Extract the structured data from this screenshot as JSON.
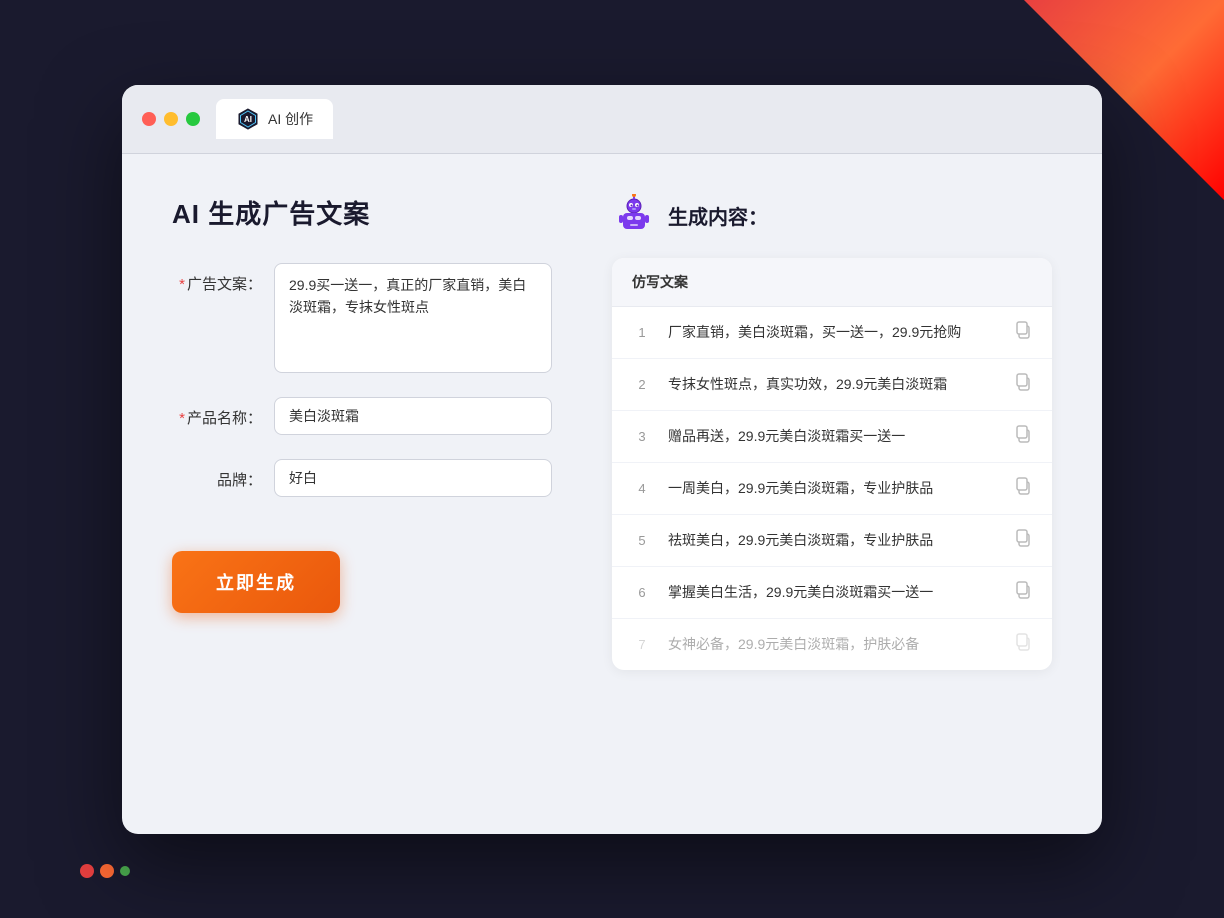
{
  "background": {
    "colors": {
      "main": "#1a1a2e",
      "accent_red": "#e84040"
    }
  },
  "browser": {
    "tab": {
      "label": "AI 创作"
    },
    "window_controls": {
      "close_label": "",
      "minimize_label": "",
      "maximize_label": ""
    }
  },
  "page": {
    "title": "AI 生成广告文案"
  },
  "form": {
    "ad_copy_label": "广告文案：",
    "ad_copy_required": "*",
    "ad_copy_value": "29.9买一送一，真正的厂家直销，美白淡斑霜，专抹女性斑点",
    "product_name_label": "产品名称：",
    "product_name_required": "*",
    "product_name_value": "美白淡斑霜",
    "brand_label": "品牌：",
    "brand_value": "好白",
    "generate_button": "立即生成"
  },
  "result": {
    "header_title": "生成内容：",
    "table_header": "仿写文案",
    "items": [
      {
        "num": "1",
        "text": "厂家直销，美白淡斑霜，买一送一，29.9元抢购",
        "dimmed": false
      },
      {
        "num": "2",
        "text": "专抹女性斑点，真实功效，29.9元美白淡斑霜",
        "dimmed": false
      },
      {
        "num": "3",
        "text": "赠品再送，29.9元美白淡斑霜买一送一",
        "dimmed": false
      },
      {
        "num": "4",
        "text": "一周美白，29.9元美白淡斑霜，专业护肤品",
        "dimmed": false
      },
      {
        "num": "5",
        "text": "祛斑美白，29.9元美白淡斑霜，专业护肤品",
        "dimmed": false
      },
      {
        "num": "6",
        "text": "掌握美白生活，29.9元美白淡斑霜买一送一",
        "dimmed": false
      },
      {
        "num": "7",
        "text": "女神必备，29.9元美白淡斑霜，护肤必备",
        "dimmed": true
      }
    ]
  }
}
